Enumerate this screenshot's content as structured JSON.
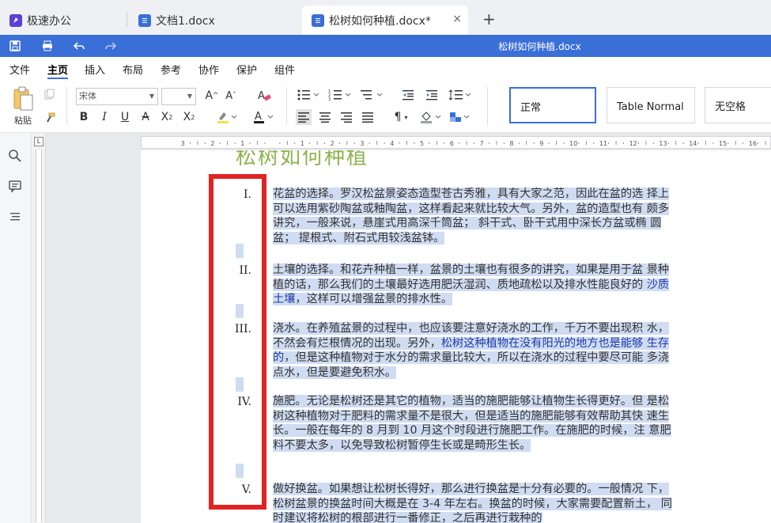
{
  "tabs": [
    {
      "label": "极速办公",
      "icon": "rocket-icon"
    },
    {
      "label": "文档1.docx",
      "icon": "doc-icon"
    },
    {
      "label": "松树如何种植.docx*",
      "icon": "doc-icon",
      "active": true
    }
  ],
  "new_tab_label": "+",
  "close_label": "×",
  "doc_title": "松树如何种植.docx",
  "menu": [
    "文件",
    "主页",
    "插入",
    "布局",
    "参考",
    "协作",
    "保护",
    "组件"
  ],
  "active_menu": "主页",
  "ribbon": {
    "paste_label": "粘贴",
    "font_name": "宋体",
    "font_size": "",
    "styles": [
      "正常",
      "Table Normal",
      "无空格"
    ]
  },
  "document": {
    "heading": "松树如何种植",
    "items": [
      {
        "numeral": "I.",
        "text_parts": [
          {
            "t": "花盆的选择。罗汉松盆景姿态造型苍古秀雅，具有大家之范，因此在盆的选 择上可以选用紫砂陶盆或釉陶盆，这样看起来就比较大气。另外，盆的造型也有 颇多讲究，一般来说，悬崖式用高深千筒盆； 斜干式、卧干式用中深长方盆或椭 圆盆； 提根式、附石式用较浅盆钵。",
            "link": false
          }
        ]
      },
      {
        "numeral": "II.",
        "text_parts": [
          {
            "t": "土壤的选择。和花卉种植一样，盆景的土壤也有很多的讲究，如果是用于盆 景种植的话，那么我们的土壤最好选用肥沃湿润、质地疏松以及排水性能良好的 ",
            "link": false
          },
          {
            "t": "沙质土壤",
            "link": true
          },
          {
            "t": "，这样可以增强盆景的排水性。",
            "link": false
          }
        ]
      },
      {
        "numeral": "III.",
        "text_parts": [
          {
            "t": "浇水。在养殖盆景的过程中，也应该要注意好浇水的工作，千万不要出现积 水，不然会有烂根情况的出现。另外，",
            "link": false
          },
          {
            "t": "松树这种植物在没有阳光的地方也是能够 生存的",
            "link": true
          },
          {
            "t": "，但是这种植物对于水分的需求量比较大，所以在浇水的过程中要尽可能 多浇点水，但是要避免积水。",
            "link": false
          }
        ]
      },
      {
        "numeral": "IV.",
        "text_parts": [
          {
            "t": "施肥。无论是松树还是其它的植物，适当的施肥能够让植物生长得更好。但 是松树这种植物对于肥料的需求量不是很大，但是适当的施肥能够有效帮助其快 速生长。一般在每年的 8 月到 10 月这个时段进行施肥工作。在施肥的时候，注 意肥料不要太多，以免导致松树暂停生长或是畸形生长。",
            "link": false
          }
        ]
      },
      {
        "numeral": "V.",
        "text_parts": [
          {
            "t": "做好换盆。如果想让松树长得好，那么进行换盆是十分有必要的。一般情况 下，松树盆景的换盆时间大概是在 3-4 年左右。换盆的时候，大家需要配置新土， 同时建议将松树的根部进行一番修正，之后再进行栽种的",
            "link": false
          }
        ]
      }
    ]
  },
  "colors": {
    "accent": "#3a6fd8",
    "highlight": "#cfdcf2",
    "red_box": "#e02424",
    "heading": "#8fb34f",
    "link": "#1c3aa9"
  }
}
